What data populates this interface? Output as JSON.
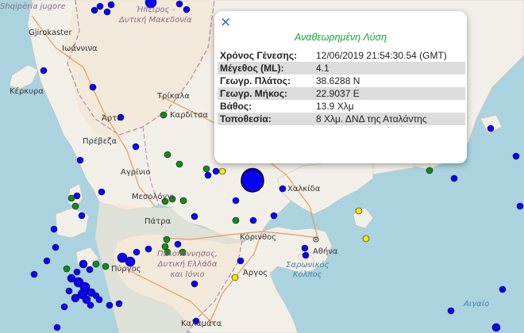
{
  "map": {
    "colors": {
      "sea": "#aad3df",
      "land": "#f2efe9",
      "region": "#f1e8d5",
      "border": "#b88aa8",
      "road": "#e29a5a",
      "blue": "#0a00ff",
      "green": "#138a1a",
      "yellow": "#f5e600"
    },
    "place_labels": [
      {
        "id": "shqiperia",
        "text": "Shqipëria jugore",
        "cls": "region"
      },
      {
        "id": "gjirokaster",
        "text": "Gjirokaster",
        "cls": "town"
      },
      {
        "id": "ipeiros",
        "text": "Ήπειρος -\nΔυτική Μακεδονία",
        "cls": "region"
      },
      {
        "id": "ioannina",
        "text": "Ιωάννινα",
        "cls": "town"
      },
      {
        "id": "kerkyra",
        "text": "Κέρκυρα",
        "cls": "town"
      },
      {
        "id": "trikala",
        "text": "Τρίκαλα",
        "cls": "town"
      },
      {
        "id": "karditsa",
        "text": "Καρδίτσα",
        "cls": "town"
      },
      {
        "id": "arta",
        "text": "Άρτα",
        "cls": "town"
      },
      {
        "id": "preveza",
        "text": "Πρέβεζα",
        "cls": "town"
      },
      {
        "id": "agrinio",
        "text": "Αγρίνιο",
        "cls": "town"
      },
      {
        "id": "mesolongi",
        "text": "Μεσολόγγι",
        "cls": "town"
      },
      {
        "id": "patra",
        "text": "Πάτρα",
        "cls": "town"
      },
      {
        "id": "chalkida",
        "text": "Χαλκίδα",
        "cls": "town"
      },
      {
        "id": "korinthos",
        "text": "Κόρινθος",
        "cls": "town"
      },
      {
        "id": "athina",
        "text": "Αθήνα",
        "cls": "town"
      },
      {
        "id": "peloponnisos",
        "text": "Πελοπόννησος,\nΔυτική Ελλάδα\nκαι Ιόνιο",
        "cls": "region"
      },
      {
        "id": "pyrgos",
        "text": "Πύργος",
        "cls": "town"
      },
      {
        "id": "argos",
        "text": "Άργος",
        "cls": "town"
      },
      {
        "id": "saronikos",
        "text": "Σαρωνικός\nΚόλπος",
        "cls": "sea"
      },
      {
        "id": "aigaio",
        "text": "Αιγαίο",
        "cls": "sea"
      },
      {
        "id": "kalamata",
        "text": "Καλαμάτα",
        "cls": "town"
      }
    ],
    "markers": [
      [
        190,
        3,
        "blue",
        7
      ],
      [
        126,
        8,
        "blue",
        4
      ],
      [
        140,
        6,
        "blue",
        4
      ],
      [
        119,
        13,
        "blue",
        4
      ],
      [
        135,
        15,
        "blue",
        4
      ],
      [
        226,
        5,
        "blue",
        4
      ],
      [
        235,
        12,
        "blue",
        4
      ],
      [
        55,
        89,
        "blue",
        4
      ],
      [
        117,
        110,
        "blue",
        4
      ],
      [
        152,
        148,
        "blue",
        4
      ],
      [
        171,
        185,
        "blue",
        4
      ],
      [
        101,
        202,
        "blue",
        4
      ],
      [
        97,
        247,
        "blue",
        4
      ],
      [
        90,
        250,
        "green",
        4
      ],
      [
        95,
        260,
        "green",
        4
      ],
      [
        103,
        272,
        "blue",
        4
      ],
      [
        128,
        242,
        "blue",
        4
      ],
      [
        206,
        145,
        "green",
        4
      ],
      [
        211,
        195,
        "green",
        4
      ],
      [
        226,
        207,
        "green",
        4
      ],
      [
        260,
        213,
        "green",
        4
      ],
      [
        262,
        221,
        "blue",
        4
      ],
      [
        272,
        216,
        "blue",
        4
      ],
      [
        280,
        216,
        "yellow",
        4
      ],
      [
        318,
        226,
        "blue",
        14
      ],
      [
        356,
        238,
        "blue",
        4
      ],
      [
        208,
        254,
        "green",
        4
      ],
      [
        217,
        251,
        "green",
        4
      ],
      [
        231,
        253,
        "green",
        4
      ],
      [
        245,
        273,
        "blue",
        4
      ],
      [
        297,
        253,
        "blue",
        4
      ],
      [
        297,
        278,
        "green",
        4
      ],
      [
        319,
        278,
        "blue",
        4
      ],
      [
        345,
        272,
        "blue",
        4
      ],
      [
        210,
        302,
        "green",
        4
      ],
      [
        208,
        311,
        "green",
        4
      ],
      [
        211,
        318,
        "green",
        4
      ],
      [
        187,
        314,
        "blue",
        4
      ],
      [
        172,
        318,
        "blue",
        4
      ],
      [
        154,
        325,
        "blue",
        6
      ],
      [
        164,
        330,
        "blue",
        6
      ],
      [
        121,
        333,
        "green",
        4
      ],
      [
        133,
        336,
        "green",
        4
      ],
      [
        105,
        333,
        "blue",
        5
      ],
      [
        113,
        340,
        "blue",
        4
      ],
      [
        97,
        343,
        "blue",
        4
      ],
      [
        84,
        339,
        "green",
        4
      ],
      [
        90,
        351,
        "blue",
        5
      ],
      [
        99,
        356,
        "blue",
        6
      ],
      [
        107,
        362,
        "blue",
        6
      ],
      [
        115,
        369,
        "blue",
        5
      ],
      [
        104,
        371,
        "blue",
        6
      ],
      [
        95,
        376,
        "blue",
        5
      ],
      [
        109,
        378,
        "blue",
        5
      ],
      [
        121,
        373,
        "blue",
        4
      ],
      [
        87,
        367,
        "blue",
        4
      ],
      [
        114,
        385,
        "blue",
        4
      ],
      [
        125,
        378,
        "blue",
        4
      ],
      [
        81,
        387,
        "blue",
        4
      ],
      [
        138,
        385,
        "blue",
        4
      ],
      [
        150,
        383,
        "blue",
        4
      ],
      [
        72,
        413,
        "blue",
        4
      ],
      [
        59,
        329,
        "blue",
        4
      ],
      [
        43,
        346,
        "blue",
        4
      ],
      [
        68,
        289,
        "blue",
        4
      ],
      [
        70,
        312,
        "blue",
        4
      ],
      [
        224,
        308,
        "blue",
        4
      ],
      [
        230,
        318,
        "green",
        4
      ],
      [
        245,
        358,
        "blue",
        4
      ],
      [
        247,
        405,
        "blue",
        4
      ],
      [
        303,
        329,
        "blue",
        4
      ],
      [
        296,
        350,
        "yellow",
        4
      ],
      [
        385,
        322,
        "blue",
        4
      ],
      [
        384,
        313,
        "blue",
        4
      ],
      [
        541,
        215,
        "green",
        4
      ],
      [
        572,
        225,
        "blue",
        4
      ],
      [
        452,
        266,
        "yellow",
        4
      ],
      [
        461,
        301,
        "yellow",
        4
      ],
      [
        618,
        162,
        "blue",
        4
      ],
      [
        650,
        197,
        "blue",
        4
      ],
      [
        655,
        260,
        "blue",
        4
      ],
      [
        633,
        365,
        "blue",
        4
      ],
      [
        625,
        413,
        "blue",
        5
      ],
      [
        568,
        392,
        "blue",
        4
      ]
    ]
  },
  "popup": {
    "close": "×",
    "title": "Αναθεωρημένη Λύση",
    "rows": [
      {
        "k": "Χρόνος Γένεσης:",
        "v": "12/06/2019 21:54:30.54 (GMT)"
      },
      {
        "k": "Μέγεθος (ML):",
        "v": "4.1"
      },
      {
        "k": "Γεωγρ. Πλάτος:",
        "v": "38.6288 N"
      },
      {
        "k": "Γεωγρ. Μήκος:",
        "v": "22.9037 E"
      },
      {
        "k": "Βάθος:",
        "v": "13.9 Χλμ"
      },
      {
        "k": "Τοποθεσία:",
        "v": "8 Χλμ. ΔΝΔ της Αταλάντης"
      }
    ]
  }
}
